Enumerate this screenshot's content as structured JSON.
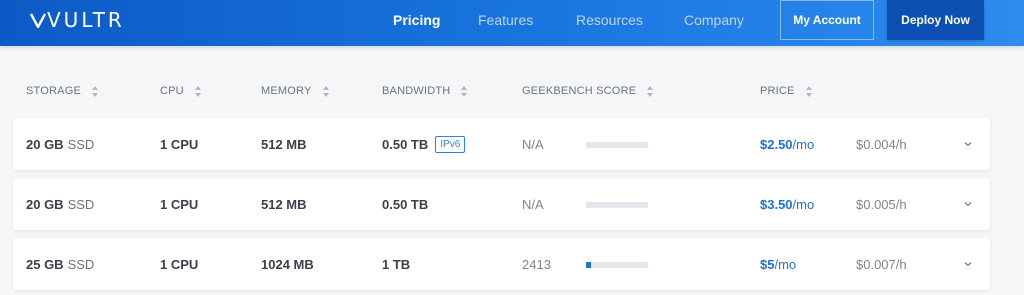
{
  "nav": {
    "logo": "VULTR",
    "links": [
      "Pricing",
      "Features",
      "Resources",
      "Company"
    ],
    "my_account": "My Account",
    "deploy_now": "Deploy Now"
  },
  "columns": [
    "STORAGE",
    "CPU",
    "MEMORY",
    "BANDWIDTH",
    "GEEKBENCH SCORE",
    "PRICE"
  ],
  "plans": [
    {
      "storage_size": "20 GB",
      "storage_type": "SSD",
      "cpu": "1 CPU",
      "memory": "512 MB",
      "bandwidth": "0.50 TB",
      "badge": "IPv6",
      "score": "N/A",
      "score_fraction": 0,
      "price": "$2.50",
      "price_unit": "/mo",
      "hourly": "$0.004/h"
    },
    {
      "storage_size": "20 GB",
      "storage_type": "SSD",
      "cpu": "1 CPU",
      "memory": "512 MB",
      "bandwidth": "0.50 TB",
      "badge": "",
      "score": "N/A",
      "score_fraction": 0,
      "price": "$3.50",
      "price_unit": "/mo",
      "hourly": "$0.005/h"
    },
    {
      "storage_size": "25 GB",
      "storage_type": "SSD",
      "cpu": "1 CPU",
      "memory": "1024 MB",
      "bandwidth": "1 TB",
      "badge": "",
      "score": "2413",
      "score_fraction": 0.08,
      "price": "$5",
      "price_unit": "/mo",
      "hourly": "$0.007/h"
    }
  ],
  "colors": {
    "nav_start": "#0c5ac6",
    "nav_end": "#2e8cef",
    "accent": "#1f6fd8",
    "deploy_button": "#0b4fb3"
  },
  "icons": {
    "sort": "sort-icon",
    "expand": "chevron-down-icon",
    "logo_mark": "vultr-v-icon"
  }
}
